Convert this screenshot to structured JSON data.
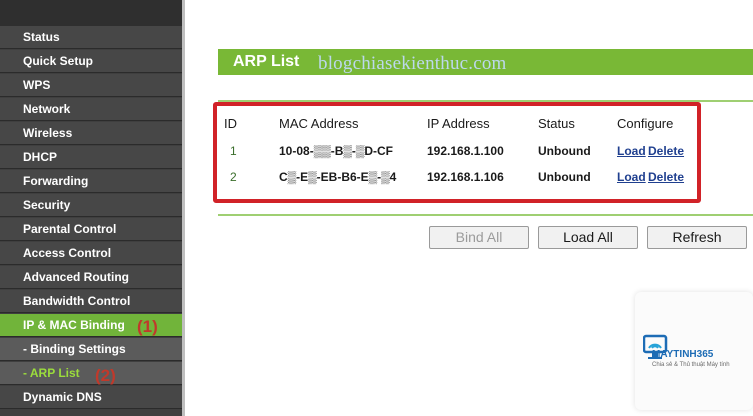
{
  "sidebar": {
    "items": [
      {
        "label": "Status"
      },
      {
        "label": "Quick Setup"
      },
      {
        "label": "WPS"
      },
      {
        "label": "Network"
      },
      {
        "label": "Wireless"
      },
      {
        "label": "DHCP"
      },
      {
        "label": "Forwarding"
      },
      {
        "label": "Security"
      },
      {
        "label": "Parental Control"
      },
      {
        "label": "Access Control"
      },
      {
        "label": "Advanced Routing"
      },
      {
        "label": "Bandwidth Control"
      },
      {
        "label": "IP & MAC Binding"
      },
      {
        "label": "- Binding Settings"
      },
      {
        "label": "- ARP List"
      },
      {
        "label": "Dynamic DNS"
      }
    ],
    "annotations": [
      "(1)",
      "(2)"
    ]
  },
  "panel": {
    "title": "ARP List",
    "watermark": "blogchiasekienthuc.com"
  },
  "table": {
    "headers": [
      "ID",
      "MAC Address",
      "IP Address",
      "Status",
      "Configure"
    ],
    "rows": [
      {
        "id": "1",
        "mac": "10-08-▒▒-B▒-▒D-CF",
        "ip": "192.168.1.100",
        "status": "Unbound",
        "load": "Load",
        "delete": "Delete"
      },
      {
        "id": "2",
        "mac": "C▒-E▒-EB-B6-E▒-▒4",
        "ip": "192.168.1.106",
        "status": "Unbound",
        "load": "Load",
        "delete": "Delete"
      }
    ]
  },
  "buttons": {
    "bind_all": "Bind All",
    "load_all": "Load All",
    "refresh": "Refresh"
  },
  "logo": {
    "name": "MAYTINH365",
    "tagline": "Chia sẻ & Thủ thuật Máy tính"
  },
  "colors": {
    "sidebar_bg": "#474747",
    "active_green": "#71b43a",
    "title_bar_green": "#79b836",
    "highlight_red": "#d12228",
    "link_blue": "#1f3f8f"
  }
}
